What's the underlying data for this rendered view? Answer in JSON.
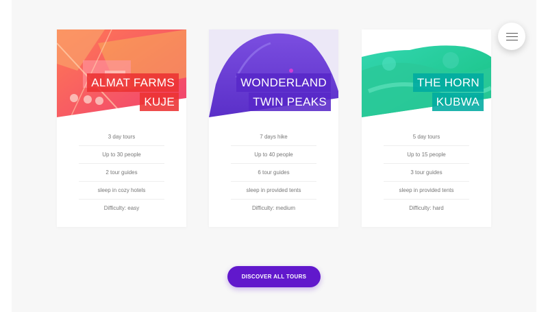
{
  "menu": {
    "icon": "hamburger-menu-icon"
  },
  "tours": [
    {
      "title_line1": "ALMAT FARMS",
      "title_line2": "KUJE",
      "color": "#ec3232",
      "details": [
        "3 day tours",
        "Up to 30 people",
        "2 tour guides",
        "sleep in cozy hotels",
        "Difficulty: easy"
      ]
    },
    {
      "title_line1": "WONDERLAND",
      "title_line2": "TWIN PEAKS",
      "color": "#5828c8",
      "details": [
        "7 days hike",
        "Up to 40 people",
        "6 tour guides",
        "sleep in provided tents",
        "Difficulty: medium"
      ]
    },
    {
      "title_line1": "THE HORN",
      "title_line2": "KUBWA",
      "color": "#00aaa0",
      "details": [
        "5 day tours",
        "Up to 15 people",
        "3 tour guides",
        "sleep in provided tents",
        "Difficulty: hard"
      ]
    }
  ],
  "cta": {
    "label": "DISCOVER ALL TOURS"
  },
  "colors": {
    "accent": "#6118cc",
    "background": "#f7f7f7"
  }
}
